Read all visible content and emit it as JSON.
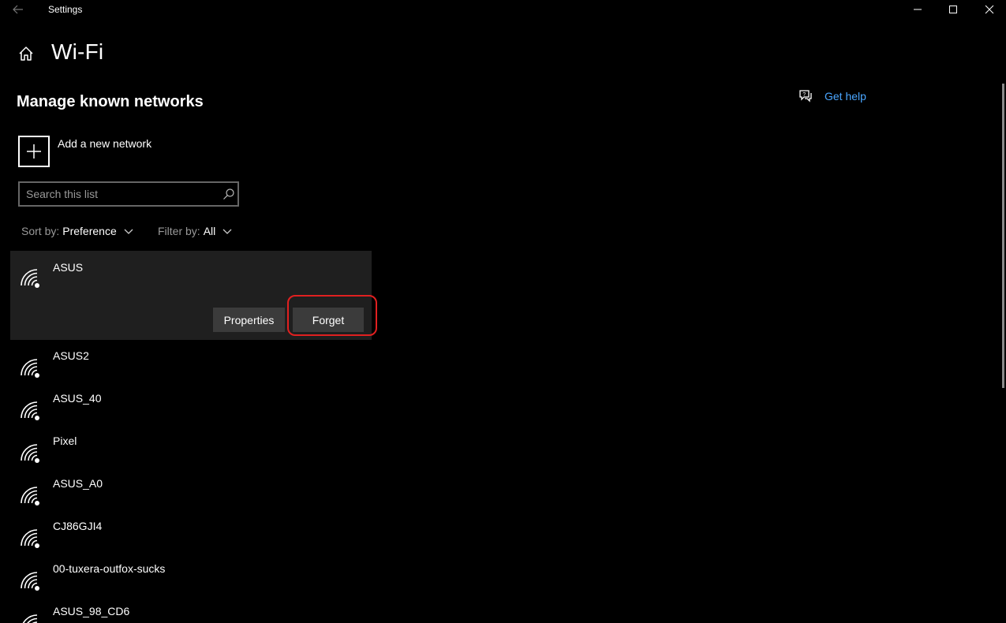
{
  "window": {
    "app_title": "Settings"
  },
  "header": {
    "page_title": "Wi-Fi"
  },
  "section": {
    "title": "Manage known networks"
  },
  "add_network": {
    "label": "Add a new network"
  },
  "search": {
    "placeholder": "Search this list"
  },
  "sort": {
    "label": "Sort by:",
    "value": "Preference"
  },
  "filter": {
    "label": "Filter by:",
    "value": "All"
  },
  "networks": [
    {
      "name": "ASUS"
    },
    {
      "name": "ASUS2"
    },
    {
      "name": "ASUS_40"
    },
    {
      "name": "Pixel"
    },
    {
      "name": "ASUS_A0"
    },
    {
      "name": "CJ86GJI4"
    },
    {
      "name": "00-tuxera-outfox-sucks"
    },
    {
      "name": "ASUS_98_CD6"
    }
  ],
  "actions": {
    "properties_label": "Properties",
    "forget_label": "Forget"
  },
  "help": {
    "label": "Get help"
  },
  "colors": {
    "background": "#000000",
    "selected_row": "#1f1f1f",
    "button": "#3b3b3b",
    "link": "#4aa6ff",
    "highlight": "#e02020"
  }
}
